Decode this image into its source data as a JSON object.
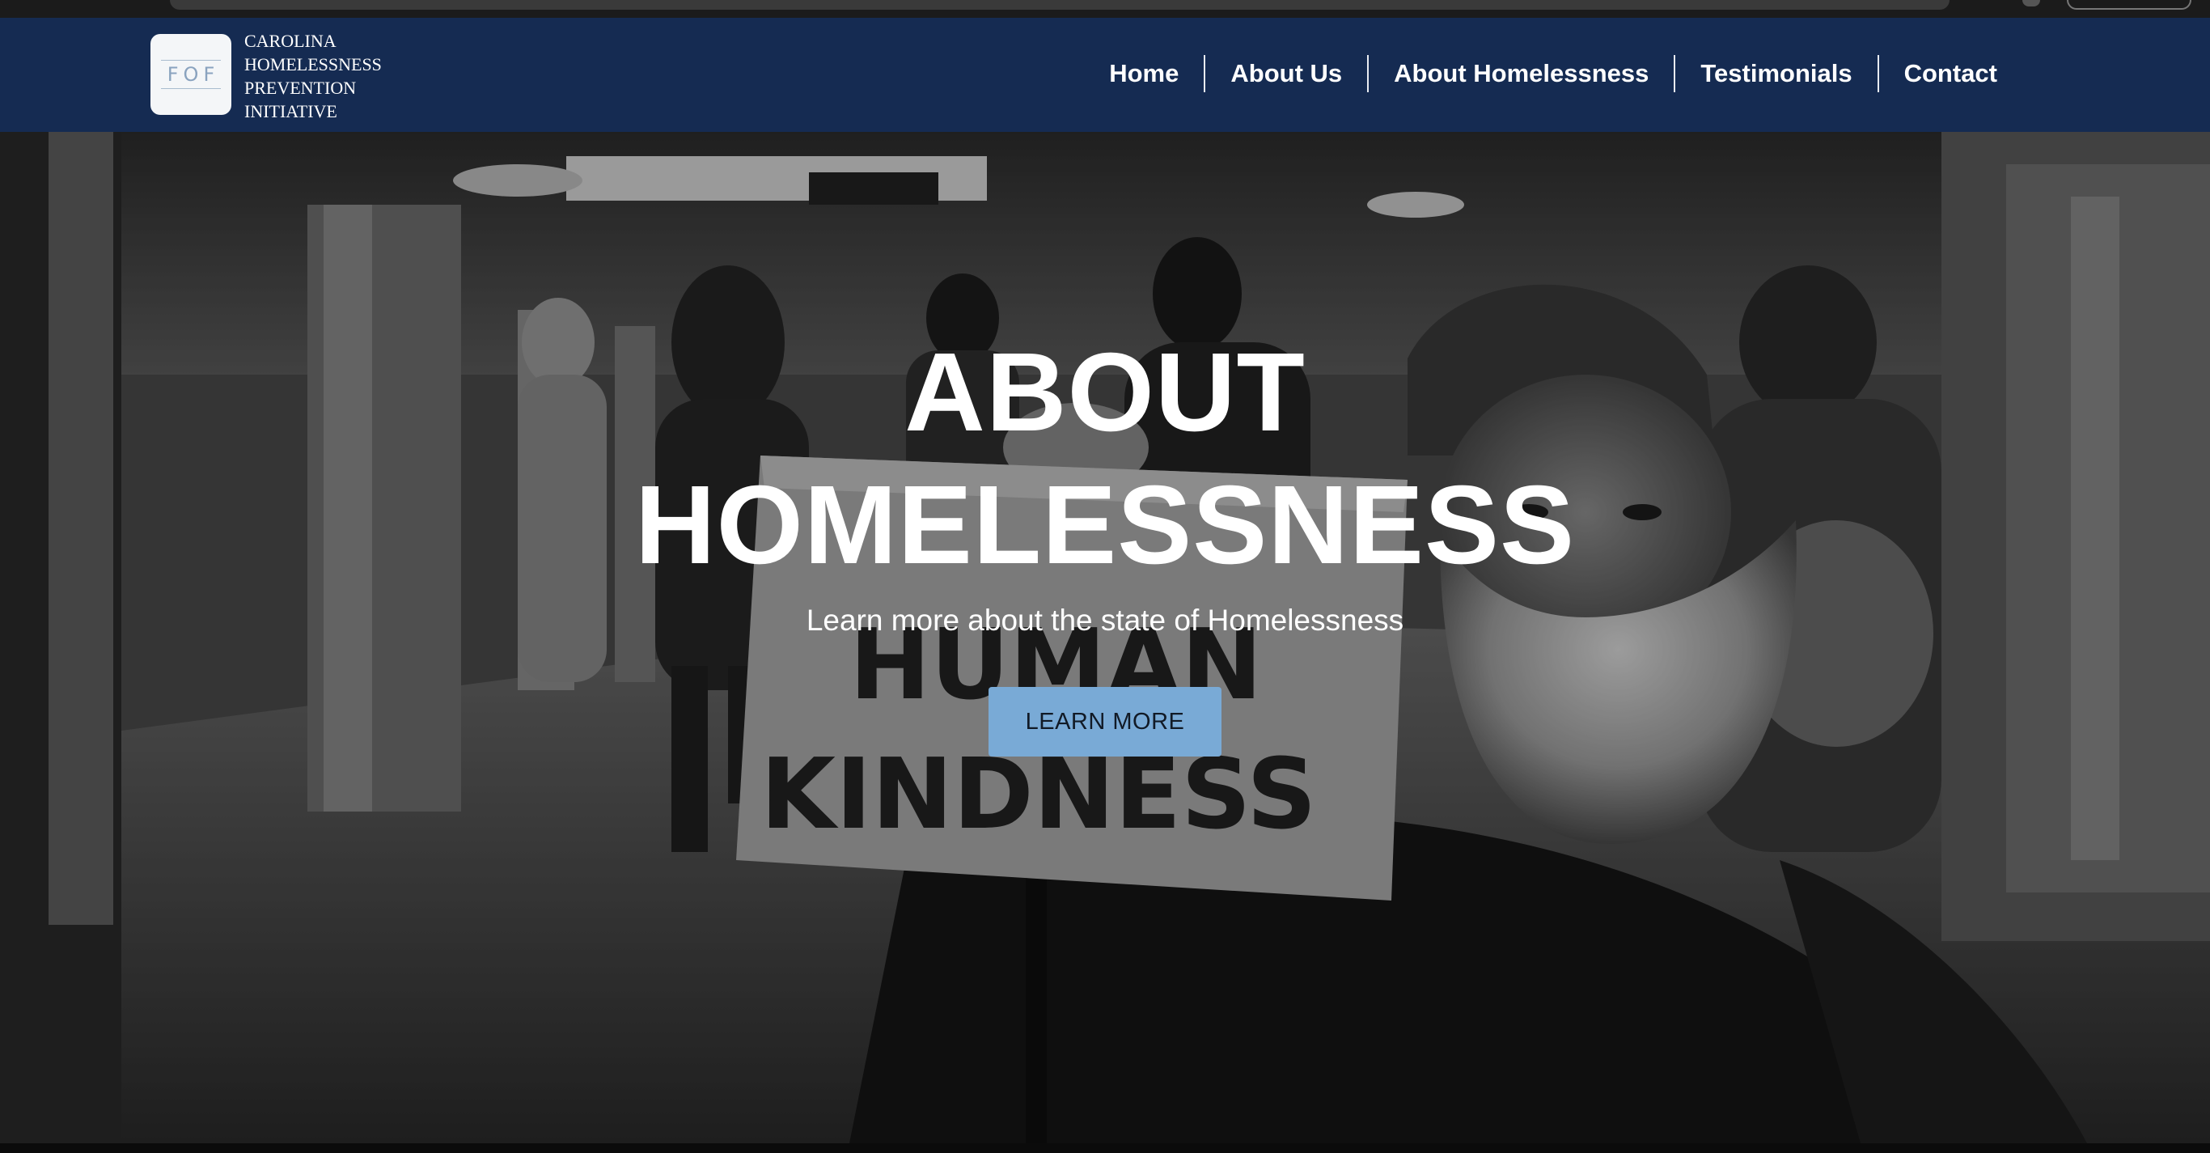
{
  "header": {
    "logo_mark": "FOF",
    "org_name_lines": [
      "CAROLINA",
      "HOMELESSNESS",
      "PREVENTION",
      "INITIATIVE"
    ]
  },
  "nav": {
    "items": [
      {
        "label": "Home"
      },
      {
        "label": "About Us"
      },
      {
        "label": "About Homelessness"
      },
      {
        "label": "Testimonials"
      },
      {
        "label": "Contact"
      }
    ]
  },
  "hero": {
    "title_lines": [
      "ABOUT",
      "HOMELESSNESS"
    ],
    "subtitle": "Learn more about the state of Homelessness",
    "cta_label": "LEARN MORE",
    "sign_text": [
      "HUMAN",
      "KINDNESS"
    ]
  },
  "colors": {
    "navbar": "#152b52",
    "cta_button": "#79aad6",
    "text_light": "#ffffff"
  }
}
